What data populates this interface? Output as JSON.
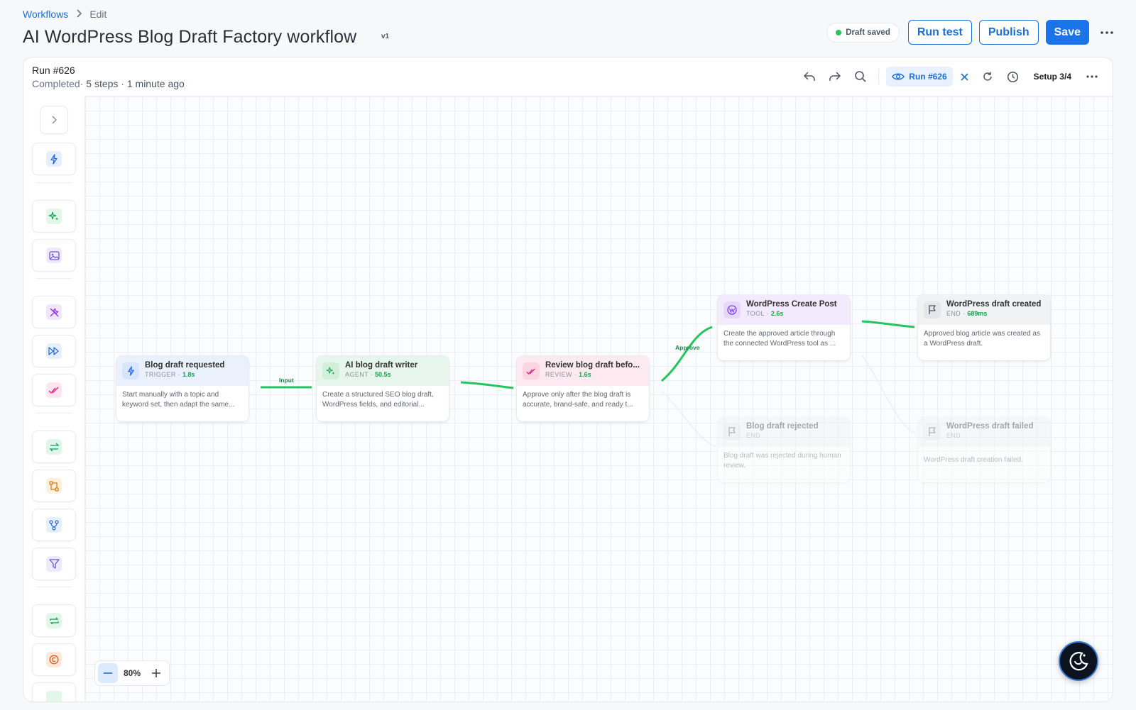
{
  "breadcrumb": {
    "root": "Workflows",
    "current": "Edit"
  },
  "page": {
    "title": "AI WordPress Blog Draft Factory workflow",
    "version": "v1"
  },
  "actions": {
    "draft_status": "Draft saved",
    "run_test": "Run test",
    "publish": "Publish",
    "save": "Save"
  },
  "run": {
    "title": "Run #626",
    "status": "Completed",
    "steps": "5 steps",
    "ago": "1 minute ago"
  },
  "toolbar": {
    "run_chip": "Run #626",
    "setup": "Setup 3/4"
  },
  "zoom": {
    "value": "80%"
  },
  "edges": {
    "input_label": "Input",
    "approve_label": "Approve"
  },
  "nodes": [
    {
      "title": "Blog draft requested",
      "kind": "TRIGGER",
      "duration": "1.8s",
      "desc": "Start manually with a topic and keyword set, then adapt the same..."
    },
    {
      "title": "AI blog draft writer",
      "kind": "AGENT",
      "duration": "50.5s",
      "desc": "Create a structured SEO blog draft, WordPress fields, and editorial..."
    },
    {
      "title": "Review blog draft befo...",
      "kind": "REVIEW",
      "duration": "1.6s",
      "desc": "Approve only after the blog draft is accurate, brand-safe, and ready t..."
    },
    {
      "title": "WordPress Create Post",
      "kind": "TOOL",
      "duration": "2.6s",
      "desc": "Create the approved article through the connected WordPress tool as ..."
    },
    {
      "title": "WordPress draft created",
      "kind": "END",
      "duration": "689ms",
      "desc": "Approved blog article was created as a WordPress draft."
    },
    {
      "title": "Blog draft rejected",
      "kind": "END",
      "duration": "",
      "desc": "Blog draft was rejected during human review."
    },
    {
      "title": "WordPress draft failed",
      "kind": "END",
      "duration": "",
      "desc": "WordPress draft creation failed."
    }
  ],
  "colors": {
    "accent": "#1a73e8",
    "success": "#22c55e",
    "edge": "#22c55e"
  }
}
